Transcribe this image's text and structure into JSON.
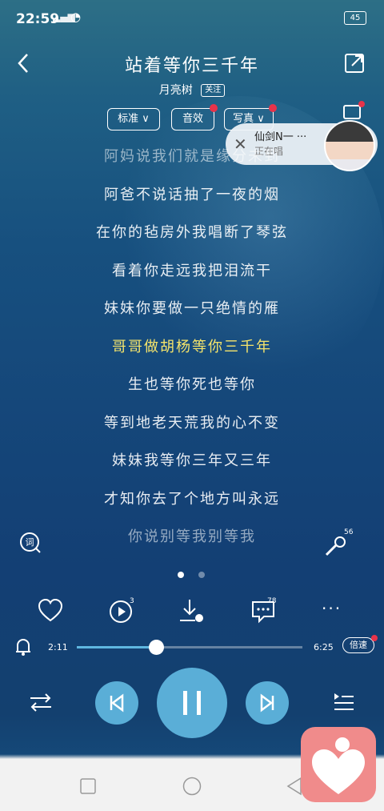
{
  "status_bar": {
    "time": "22:59",
    "signal": "4G",
    "battery": "45"
  },
  "header": {
    "title": "站着等你三千年",
    "artist": "月亮树",
    "follow_label": "关注"
  },
  "chips": [
    {
      "label": "标准",
      "has_dropdown": true,
      "has_dot": false
    },
    {
      "label": "音效",
      "has_dropdown": false,
      "has_dot": true
    },
    {
      "label": "写真",
      "has_dropdown": true,
      "has_dot": true
    }
  ],
  "popup": {
    "name": "仙剑N一 ···",
    "status": "正在唱"
  },
  "lyrics": [
    {
      "text": "阿妈说我们就是缘分未到",
      "state": "dim"
    },
    {
      "text": "阿爸不说话抽了一夜的烟",
      "state": "normal"
    },
    {
      "text": "在你的毡房外我唱断了琴弦",
      "state": "normal"
    },
    {
      "text": "看着你走远我把泪流干",
      "state": "normal"
    },
    {
      "text": "妹妹你要做一只绝情的雁",
      "state": "normal"
    },
    {
      "text": "哥哥做胡杨等你三千年",
      "state": "active"
    },
    {
      "text": "生也等你死也等你",
      "state": "normal"
    },
    {
      "text": "等到地老天荒我的心不变",
      "state": "normal"
    },
    {
      "text": "妹妹我等你三年又三年",
      "state": "normal"
    },
    {
      "text": "才知你去了个地方叫永远",
      "state": "normal"
    },
    {
      "text": "你说别等我别等我",
      "state": "dim"
    }
  ],
  "mic_count": "56",
  "actions": {
    "share_count": "3",
    "comment_count": "78"
  },
  "progress": {
    "current": "2:11",
    "total": "6:25",
    "fraction": 0.351,
    "speed_label": "倍速"
  },
  "colors": {
    "accent": "#5aaed7",
    "active_lyric": "#f5e46b",
    "dot_red": "#e8334a"
  }
}
